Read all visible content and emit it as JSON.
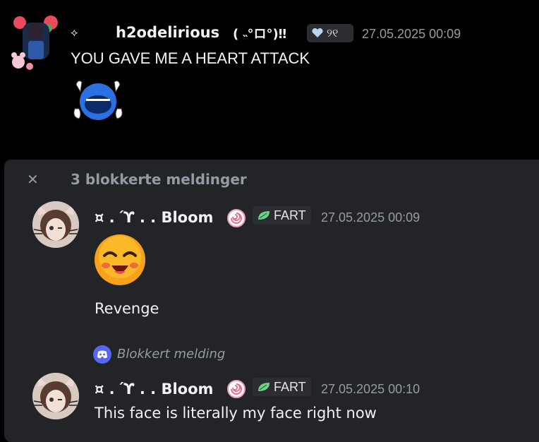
{
  "message1": {
    "prefix_glyph": "⟡",
    "username": "h2odelirious",
    "decoration": "( ˵°ロ°)‼",
    "tag_text": "୨୧",
    "timestamp": "27.05.2025 00:09",
    "text": "YOU GAVE ME A HEART ATTACK",
    "emoji": "crying-blue-face-emoji"
  },
  "blocked_group": {
    "close_glyph": "✕",
    "header": "3 blokkerte meldinger",
    "messages": [
      {
        "username": "¤ . ϓ . . Bloom",
        "tag_text": "FART",
        "timestamp": "27.05.2025 00:09",
        "emoji": "hot-face-emoji",
        "text": "Revenge"
      },
      {
        "username": "¤ . ϓ . . Bloom",
        "tag_text": "FART",
        "timestamp": "27.05.2025 00:10",
        "text": "This face is literally my face right now"
      }
    ],
    "blocked_message_label": "Blokkert melding"
  },
  "colors": {
    "background": "#000000",
    "panel": "#232428",
    "text": "#f2f3f5",
    "muted": "#949ba4",
    "discord_blurple": "#5865f2",
    "leaf_green": "#3ba55c"
  }
}
